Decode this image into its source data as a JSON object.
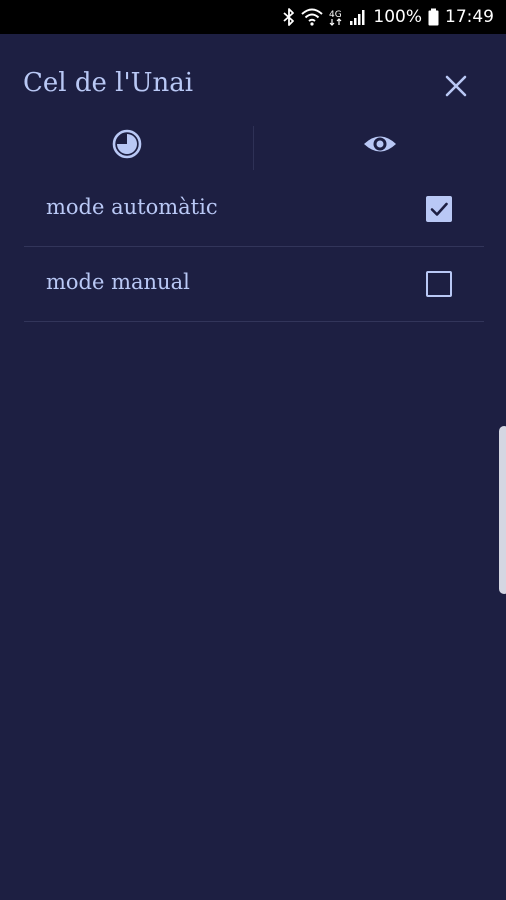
{
  "status_bar": {
    "battery": "100%",
    "time": "17:49",
    "network": "4G"
  },
  "header": {
    "title": "Cel de l'Unai",
    "close_icon": "close-icon"
  },
  "tabs": [
    {
      "icon": "clock-icon"
    },
    {
      "icon": "eye-icon"
    }
  ],
  "options": [
    {
      "label": "mode automàtic",
      "checked": true
    },
    {
      "label": "mode manual",
      "checked": false
    }
  ],
  "colors": {
    "background": "#1d1f42",
    "accent": "#b9c8f5",
    "divider": "#32355a",
    "status_bar": "#000000"
  }
}
